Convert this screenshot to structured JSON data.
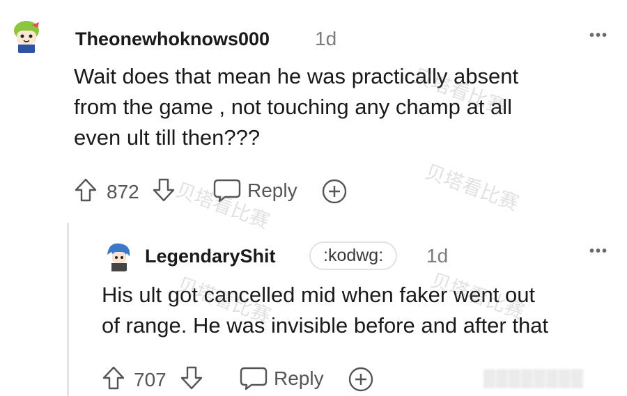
{
  "comments": [
    {
      "username": "Theonewhoknows000",
      "time": "1d",
      "body_lines": [
        "Wait does that mean he was practically absent",
        "from the game , not touching any champ at all",
        "even ult till then???"
      ],
      "upvotes": "872",
      "reply_label": "Reply",
      "more_label": "•••"
    },
    {
      "username": "LegendaryShit",
      "flair": ":kodwg:",
      "time": "1d",
      "body_lines": [
        "His ult got cancelled mid when faker went out",
        "of range. He was invisible before and after that"
      ],
      "upvotes": "707",
      "reply_label": "Reply",
      "more_label": "•••"
    }
  ],
  "watermark_text": "贝塔看比赛",
  "blurred_text": "▒▒▒▒▒▒▒▒",
  "colors": {
    "text": "#1a1a1b",
    "muted": "#7c7c7c",
    "icon": "#555555",
    "avatar1": "#8cc63f",
    "avatar2": "#3a78c9"
  }
}
